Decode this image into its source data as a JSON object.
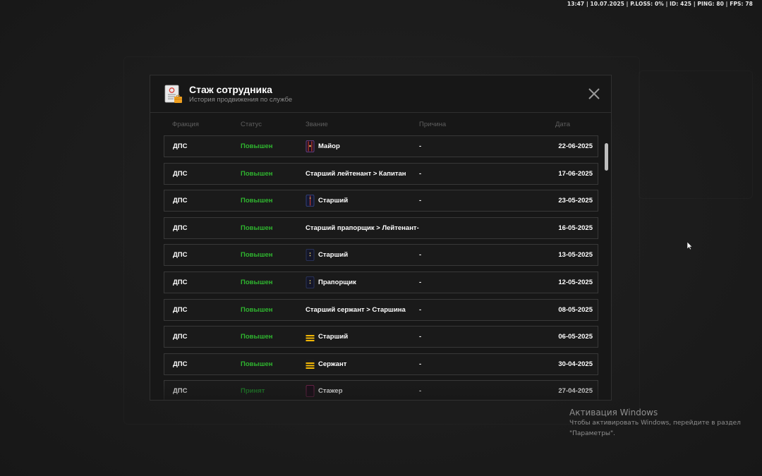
{
  "hud": {
    "text": "13:47 | 10.07.2025 | P.LOSS: 0% | ID: 425 | PING: 80 | FPS: 78"
  },
  "modal": {
    "title": "Стаж сотрудника",
    "subtitle": "История продвижения по службе",
    "icon": "document-certificate-icon",
    "close_icon": "close-icon"
  },
  "columns": {
    "faction": "Фракция",
    "status": "Статус",
    "rank": "Звание",
    "reason": "Причина",
    "date": "Дата"
  },
  "colors": {
    "status_green": "#2fb52f",
    "background": "#1b1b1b",
    "panel": "#171717",
    "row_border": "#383838"
  },
  "rows": [
    {
      "faction": "ДПС",
      "status": "Повышен",
      "rank": "Майор",
      "rank_icon": "epaulette-major-icon",
      "reason": "-",
      "date": "22-06-2025"
    },
    {
      "faction": "ДПС",
      "status": "Повышен",
      "rank": "Старший лейтенант > Капитан",
      "rank_icon": "",
      "reason": "-",
      "date": "17-06-2025"
    },
    {
      "faction": "ДПС",
      "status": "Повышен",
      "rank": "Старший",
      "rank_icon": "epaulette-officer-icon",
      "reason": "-",
      "date": "23-05-2025"
    },
    {
      "faction": "ДПС",
      "status": "Повышен",
      "rank": "Старший прапорщик > Лейтенант-",
      "rank_icon": "",
      "reason": "",
      "date": "16-05-2025"
    },
    {
      "faction": "ДПС",
      "status": "Повышен",
      "rank": "Старший",
      "rank_icon": "epaulette-warrant-icon",
      "reason": "-",
      "date": "13-05-2025"
    },
    {
      "faction": "ДПС",
      "status": "Повышен",
      "rank": "Прапорщик",
      "rank_icon": "epaulette-warrant-icon",
      "reason": "-",
      "date": "12-05-2025"
    },
    {
      "faction": "ДПС",
      "status": "Повышен",
      "rank": "Старший сержант > Старшина",
      "rank_icon": "",
      "reason": "-",
      "date": "08-05-2025"
    },
    {
      "faction": "ДПС",
      "status": "Повышен",
      "rank": "Старший",
      "rank_icon": "epaulette-sergeant-icon",
      "reason": "-",
      "date": "06-05-2025"
    },
    {
      "faction": "ДПС",
      "status": "Повышен",
      "rank": "Сержант",
      "rank_icon": "epaulette-sergeant-icon",
      "reason": "-",
      "date": "30-04-2025"
    },
    {
      "faction": "ДПС",
      "status": "Принят",
      "rank": "Стажер",
      "rank_icon": "epaulette-trainee-icon",
      "reason": "-",
      "date": "27-04-2025"
    }
  ],
  "windows_watermark": {
    "title": "Активация Windows",
    "line1": "Чтобы активировать Windows, перейдите в раздел",
    "line2": "\"Параметры\"."
  }
}
